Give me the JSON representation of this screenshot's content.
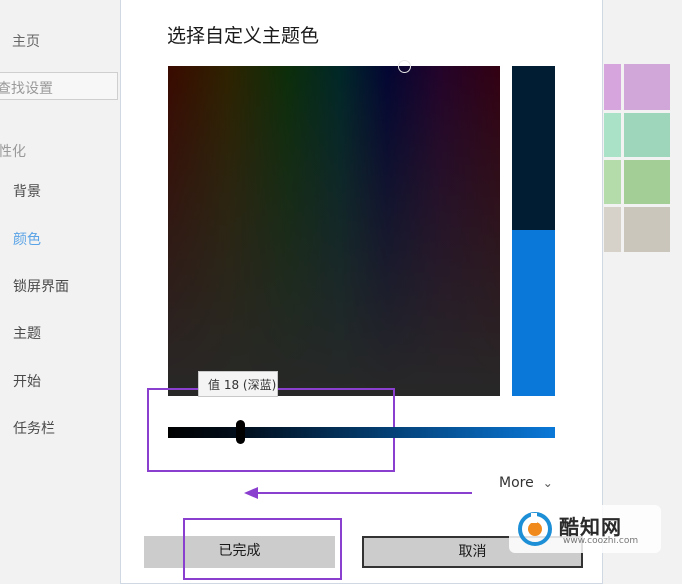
{
  "sidebar": {
    "home": "主页",
    "search_placeholder": "查找设置",
    "section": "性化",
    "items": [
      {
        "label": "背景"
      },
      {
        "label": "颜色"
      },
      {
        "label": "锁屏界面"
      },
      {
        "label": "主题"
      },
      {
        "label": "开始"
      },
      {
        "label": "任务栏"
      }
    ],
    "active_item": "颜色"
  },
  "dialog": {
    "title": "选择自定义主题色",
    "tooltip": "值 18 (深蓝)",
    "brightness_value": 18,
    "more_label": "More",
    "done_button": "已完成",
    "cancel_button": "取消",
    "colors": {
      "preview_old": "#001d33",
      "preview_new": "#0a78d8",
      "highlight": "#8a3fcf"
    }
  },
  "background_swatches": {
    "colors": [
      "#d7a5dd",
      "#d0a7d8",
      "#a9e2c7",
      "#9ed6bb",
      "#b4dcaa",
      "#a3cf96",
      "#d7d2c9",
      "#cbc6bc"
    ]
  },
  "watermark": {
    "title": "酷知网",
    "url": "www.coozhi.com"
  }
}
